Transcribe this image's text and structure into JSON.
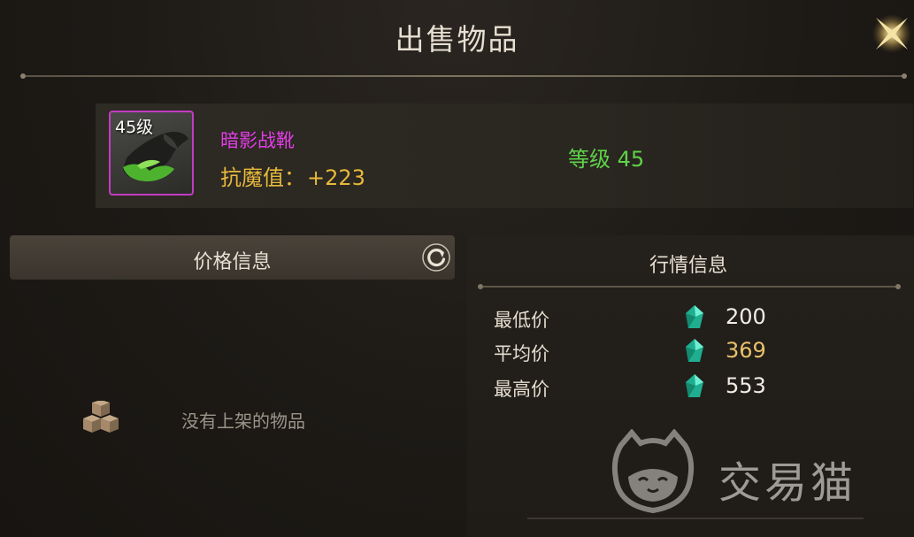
{
  "header": {
    "title": "出售物品"
  },
  "item": {
    "level_badge": "45级",
    "name": "暗影战靴",
    "stat_label": "抗魔值：",
    "stat_value": "+223",
    "grade_label": "等级",
    "grade_value": "45",
    "name_color": "#e23de6",
    "frame_color": "#c43bc4"
  },
  "price_panel": {
    "title": "价格信息",
    "empty_text": "没有上架的物品"
  },
  "market_panel": {
    "title": "行情信息",
    "rows": [
      {
        "label": "最低价",
        "value": "200",
        "color": "#f1ede4"
      },
      {
        "label": "平均价",
        "value": "369",
        "color": "#e8c16a"
      },
      {
        "label": "最高价",
        "value": "553",
        "color": "#f1ede4"
      }
    ]
  },
  "watermark": {
    "text": "交易猫"
  },
  "icons": [
    "close-icon",
    "boots-icon",
    "refresh-icon",
    "empty-box-icon",
    "gem-icon"
  ]
}
